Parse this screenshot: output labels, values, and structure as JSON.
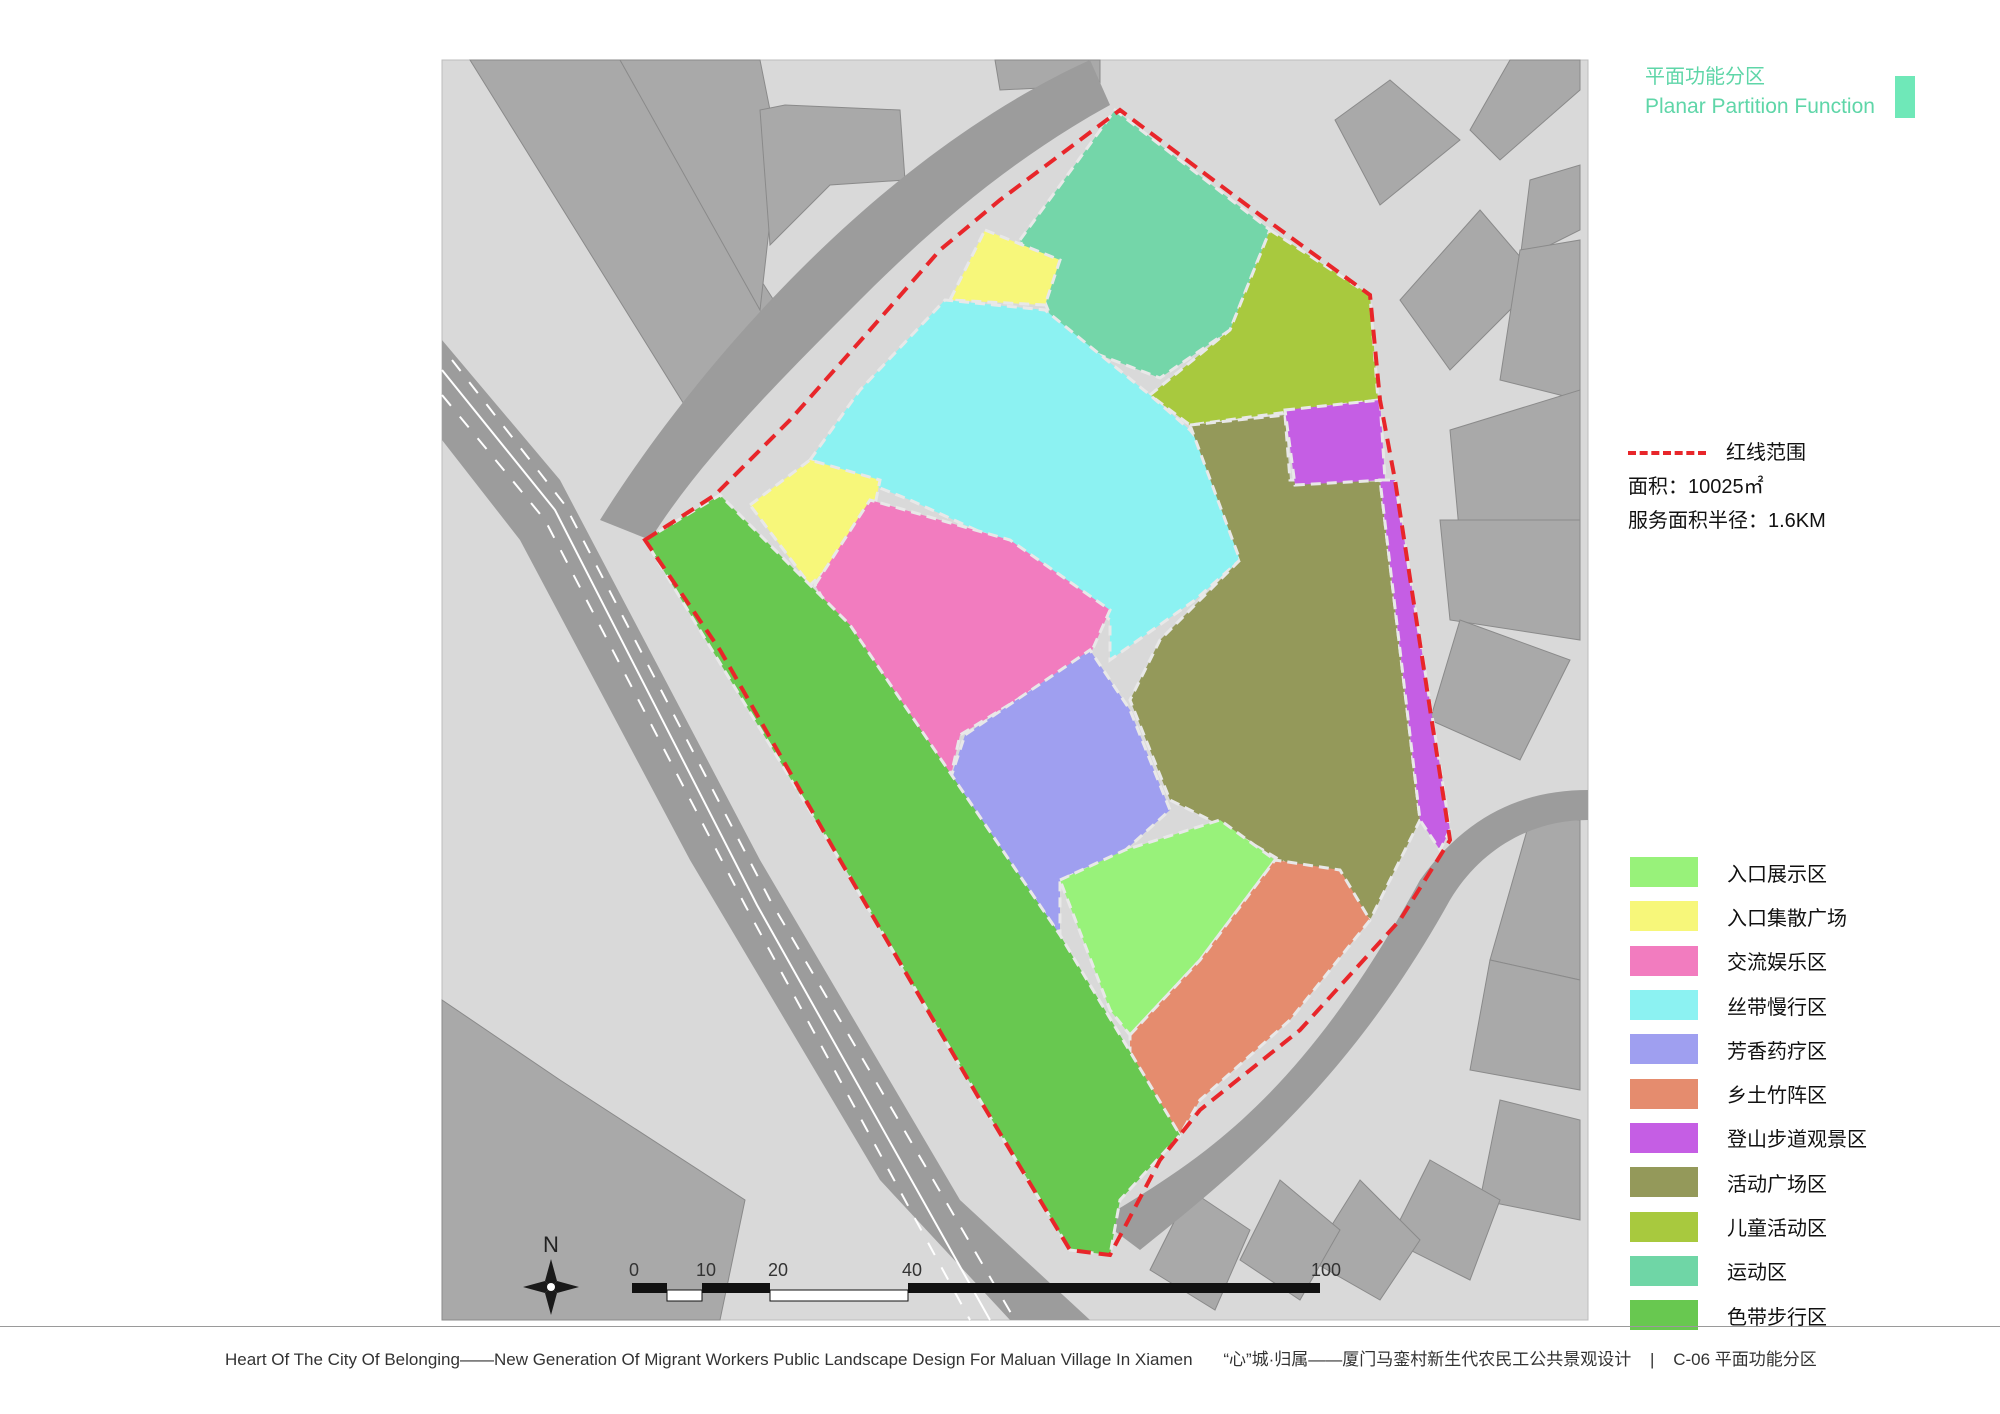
{
  "header": {
    "title_cn": "平面功能分区",
    "title_en": "Planar Partition Function",
    "accent_color": "#6fe8b8"
  },
  "boundary_legend": {
    "label": "红线范围",
    "line_color": "#e8262a",
    "area": "面积：10025㎡",
    "radius": "服务面积半径：1.6KM"
  },
  "zones": [
    {
      "label": "入口展示区",
      "color": "#98f27a"
    },
    {
      "label": "入口集散广场",
      "color": "#f7f77a"
    },
    {
      "label": "交流娱乐区",
      "color": "#f27cbf"
    },
    {
      "label": "丝带慢行区",
      "color": "#8cf2f2"
    },
    {
      "label": "芳香药疗区",
      "color": "#9f9ff0"
    },
    {
      "label": "乡土竹阵区",
      "color": "#e58c6e"
    },
    {
      "label": "登山步道观景区",
      "color": "#c55ee4"
    },
    {
      "label": "活动广场区",
      "color": "#94995a"
    },
    {
      "label": "儿童活动区",
      "color": "#a8c93e"
    },
    {
      "label": "运动区",
      "color": "#6fd6a6"
    },
    {
      "label": "色带步行区",
      "color": "#68c850"
    }
  ],
  "north_arrow": {
    "label": "N"
  },
  "scale_bar": {
    "ticks": [
      "0",
      "10",
      "20",
      "40",
      "100"
    ]
  },
  "footer": {
    "title_en": "Heart Of The City Of Belonging——New Generation Of Migrant Workers Public Landscape Design  For  Maluan  Village  In  Xiamen",
    "title_cn": "“心”城·归属——厦门马銮村新生代农民工公共景观设计",
    "separator": "|",
    "sheet": "C-06  平面功能分区"
  }
}
